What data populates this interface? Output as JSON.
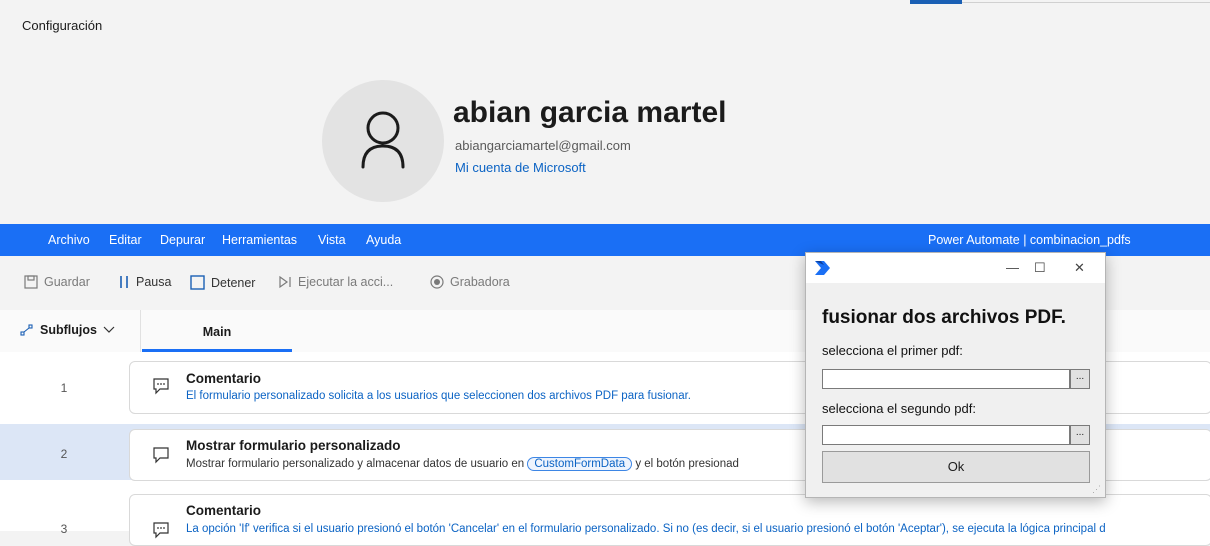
{
  "settings": {
    "title": "Configuración",
    "user_name": "abian garcia martel",
    "email": "abiangarciamartel@gmail.com",
    "account_link": "Mi cuenta de Microsoft"
  },
  "menubar": {
    "items": [
      "Archivo",
      "Editar",
      "Depurar",
      "Herramientas",
      "Vista",
      "Ayuda"
    ],
    "app_title": "Power Automate | combinacion_pdfs"
  },
  "toolbar": {
    "save": "Guardar",
    "pause": "Pausa",
    "stop": "Detener",
    "run_action": "Ejecutar la acci...",
    "recorder": "Grabadora"
  },
  "tabs": {
    "subflows": "Subflujos",
    "main": "Main"
  },
  "steps": [
    {
      "num": "1",
      "title": "Comentario",
      "desc": "El formulario personalizado solicita a los usuarios que seleccionen dos archivos PDF para fusionar."
    },
    {
      "num": "2",
      "title": "Mostrar formulario personalizado",
      "desc_before": "Mostrar formulario personalizado y almacenar datos de usuario en",
      "variable": "CustomFormData",
      "desc_after": "y el botón presionad"
    },
    {
      "num": "3",
      "title": "Comentario",
      "desc": "La opción 'If' verifica si el usuario presionó el botón 'Cancelar' en el formulario personalizado. Si no (es decir, si el usuario presionó el botón 'Aceptar'), se ejecuta la lógica principal d"
    }
  ],
  "dialog": {
    "heading": "fusionar dos archivos PDF.",
    "label1": "selecciona el primer pdf:",
    "label2": "selecciona el segundo pdf:",
    "browse": "...",
    "ok": "Ok",
    "minimize": "—",
    "maximize": "☐",
    "close": "✕"
  },
  "colors": {
    "accent": "#1a6ff5",
    "link": "#0b63c4",
    "selected_row": "#dce6f6"
  }
}
